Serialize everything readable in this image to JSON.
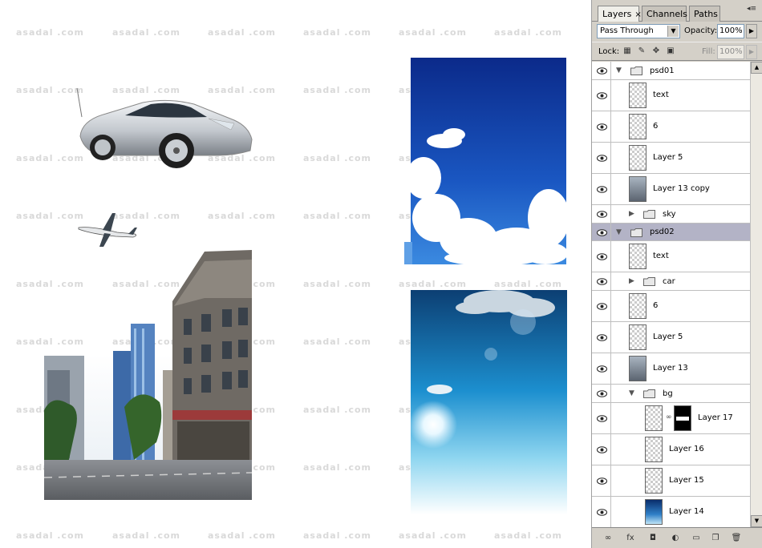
{
  "watermark": "asadal .com",
  "panel": {
    "tabs": [
      {
        "label": "Layers",
        "close": "×"
      },
      {
        "label": "Channels"
      },
      {
        "label": "Paths"
      }
    ],
    "blend_mode": "Pass Through",
    "opacity_label": "Opacity:",
    "opacity_value": "100%",
    "lock_label": "Lock:",
    "fill_label": "Fill:",
    "fill_value": "100%"
  },
  "layers": [
    {
      "name": "psd01",
      "kind": "group",
      "expanded": true
    },
    {
      "name": "text",
      "kind": "layer",
      "thumb": "transparent"
    },
    {
      "name": "6",
      "kind": "layer",
      "thumb": "transparent"
    },
    {
      "name": "Layer 5",
      "kind": "layer",
      "thumb": "transparent"
    },
    {
      "name": "Layer 13 copy",
      "kind": "layer",
      "thumb": "city"
    },
    {
      "name": "sky",
      "kind": "group",
      "expanded": false
    },
    {
      "name": "psd02",
      "kind": "group",
      "expanded": true,
      "selected": true
    },
    {
      "name": "text",
      "kind": "layer",
      "thumb": "transparent"
    },
    {
      "name": "car",
      "kind": "group",
      "expanded": false
    },
    {
      "name": "6",
      "kind": "layer",
      "thumb": "transparent"
    },
    {
      "name": "Layer 5",
      "kind": "layer",
      "thumb": "transparent"
    },
    {
      "name": "Layer 13",
      "kind": "layer",
      "thumb": "city"
    },
    {
      "name": "bg",
      "kind": "group",
      "expanded": true
    },
    {
      "name": "Layer 17",
      "kind": "layer",
      "thumb": "transparent",
      "mask": true
    },
    {
      "name": "Layer 16",
      "kind": "layer",
      "thumb": "transparent"
    },
    {
      "name": "Layer 15",
      "kind": "layer",
      "thumb": "transparent"
    },
    {
      "name": "Layer 14",
      "kind": "layer",
      "thumb": "sky"
    }
  ],
  "bottom_icons": [
    "link-icon",
    "fx-icon",
    "mask-icon",
    "adjustment-icon",
    "new-group-icon",
    "new-layer-icon",
    "trash-icon"
  ]
}
